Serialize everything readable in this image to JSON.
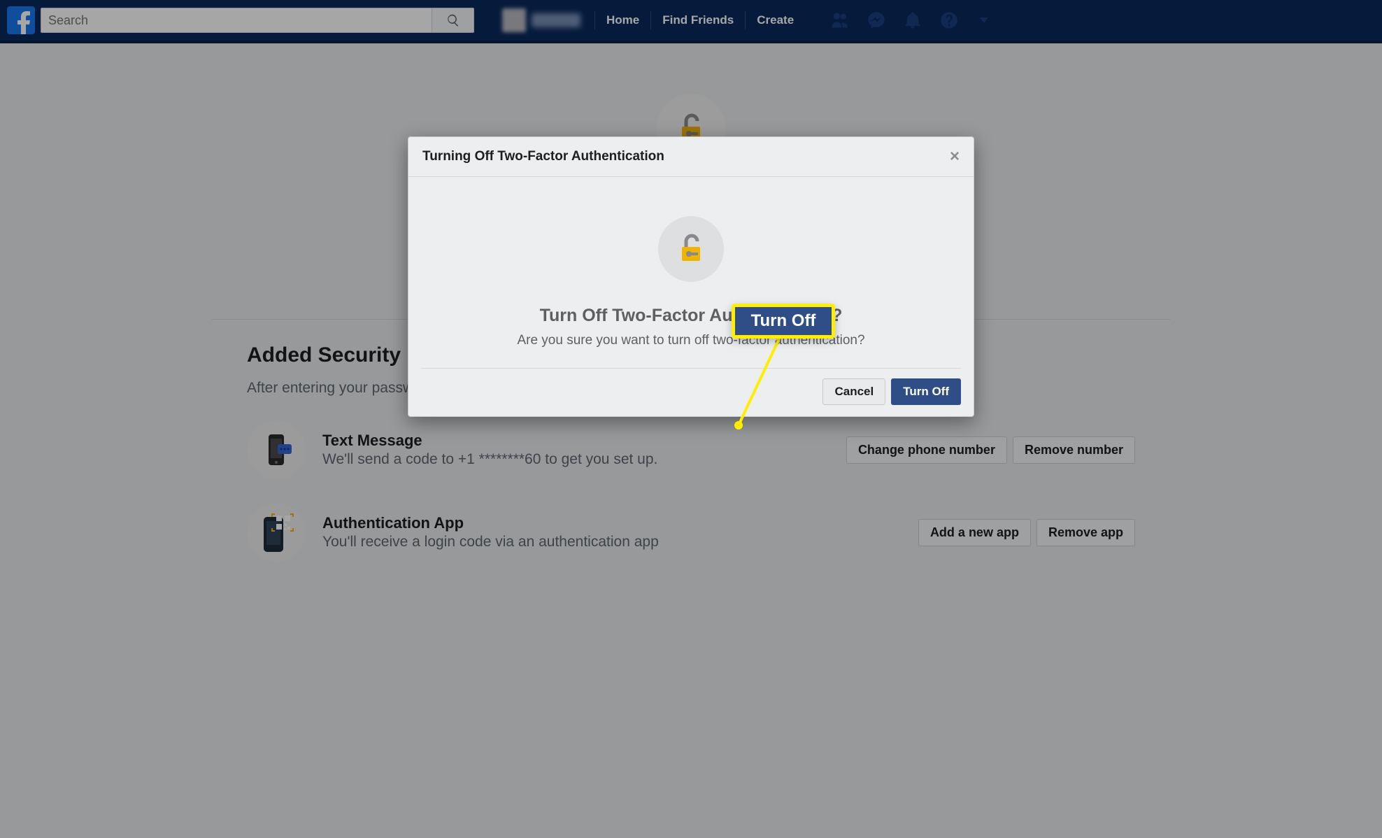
{
  "nav": {
    "search_placeholder": "Search",
    "links": [
      "Home",
      "Find Friends",
      "Create"
    ]
  },
  "page": {
    "section_title": "Added Security",
    "section_sub": "After entering your passwo",
    "items": [
      {
        "title": "Text Message",
        "desc": "We'll send a code to +1 ********60 to get you set up.",
        "actions": [
          "Change phone number",
          "Remove number"
        ]
      },
      {
        "title": "Authentication App",
        "desc": "You'll receive a login code via an authentication app",
        "actions": [
          "Add a new app",
          "Remove app"
        ]
      }
    ]
  },
  "dialog": {
    "title": "Turning Off Two-Factor Authentication",
    "heading": "Turn Off Two-Factor Authentication?",
    "body": "Are you sure you want to turn off two-factor authentication?",
    "cancel": "Cancel",
    "primary": "Turn Off"
  },
  "callout": {
    "label": "Turn Off"
  }
}
